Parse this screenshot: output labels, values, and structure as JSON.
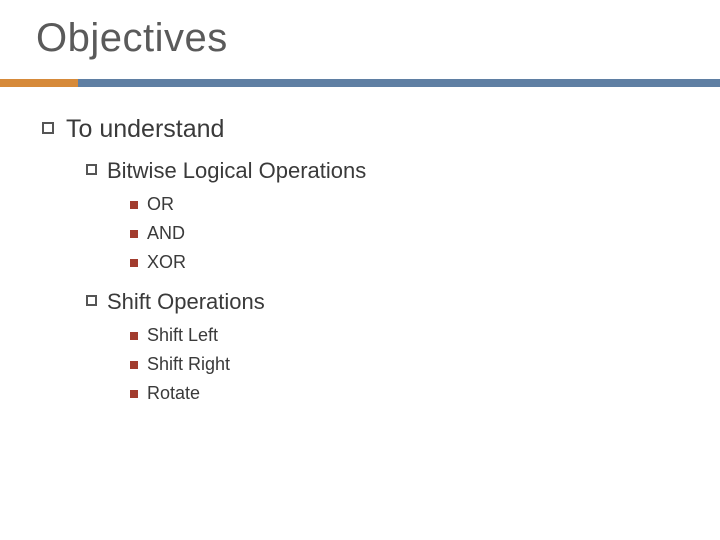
{
  "title": "Objectives",
  "lvl1": {
    "text": "To understand"
  },
  "lvl2a": {
    "text": "Bitwise Logical Operations"
  },
  "lvl3a": [
    {
      "text": "OR"
    },
    {
      "text": "AND"
    },
    {
      "text": "XOR"
    }
  ],
  "lvl2b": {
    "text": "Shift Operations"
  },
  "lvl3b": [
    {
      "text": "Shift Left"
    },
    {
      "text": "Shift Right"
    },
    {
      "text": "Rotate"
    }
  ]
}
